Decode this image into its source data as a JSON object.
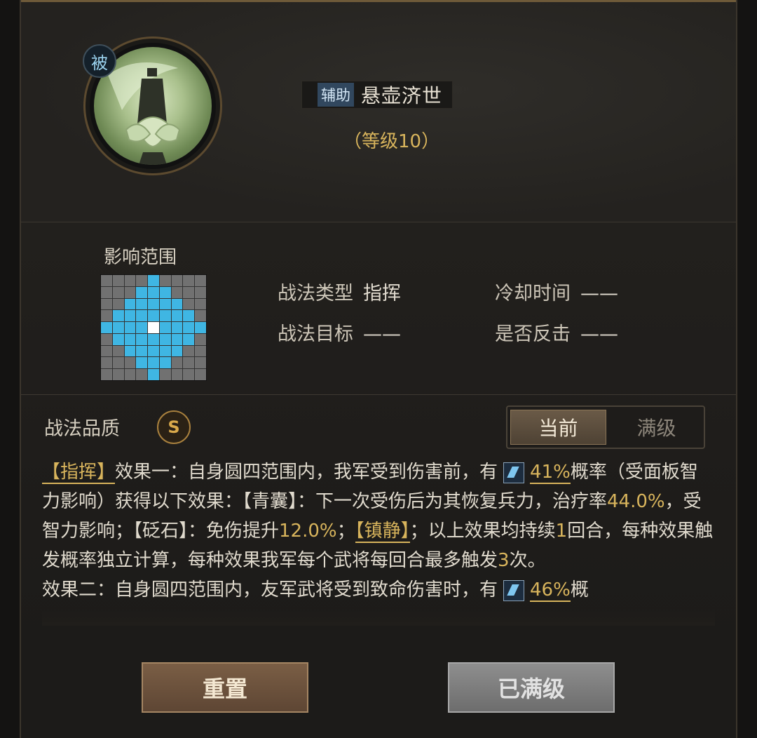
{
  "skill": {
    "passive_badge": "被",
    "type_tag": "辅助",
    "name": "悬壶济世",
    "level_text": "（等级10）"
  },
  "range": {
    "label": "影响范围"
  },
  "info": {
    "type_label": "战法类型",
    "type_value": "指挥",
    "cooldown_label": "冷却时间",
    "cooldown_value": "——",
    "target_label": "战法目标",
    "target_value": "——",
    "counter_label": "是否反击",
    "counter_value": "——"
  },
  "quality": {
    "label": "战法品质",
    "value": "S"
  },
  "toggle": {
    "current": "当前",
    "max": "满级"
  },
  "description": {
    "p1_tag": "【指挥】",
    "p1_a": "效果一：自身圆四范围内，我军受到伤害前，有",
    "p1_rate": "41%",
    "p1_b": "概率（受面板智力影响）获得以下效果：【青囊】：下一次受伤后为其恢复兵力，治疗率",
    "p1_heal": "44.0%",
    "p1_c": "，受智力影响；【砭石】：免伤提升",
    "p1_dr": "12.0%",
    "p1_d": "；",
    "p1_tag2": "【镇静】",
    "p1_e": "；以上效果均持续",
    "p1_turns": "1",
    "p1_f": "回合，每种效果触发概率独立计算，每种效果我军每个武将每回合最多触发",
    "p1_times": "3",
    "p1_g": "次。",
    "p2_a": "效果二：自身圆四范围内，友军武将受到致命伤害时，有",
    "p2_rate": "46%",
    "p2_b": "概"
  },
  "buttons": {
    "reset": "重置",
    "maxed": "已满级"
  },
  "colors": {
    "gold": "#d8b45c",
    "range_blue": "#3fb6e3"
  }
}
